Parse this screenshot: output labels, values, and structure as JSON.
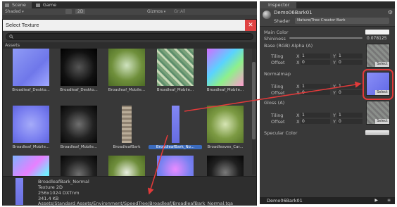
{
  "scene": {
    "tabs": [
      "Scene",
      "Game"
    ],
    "toolbar": {
      "shading": "Shaded",
      "mode": "2D",
      "gizmos": "Gizmos",
      "search": "Gr:All"
    }
  },
  "dialog": {
    "title": "Select Texture",
    "close": "✕",
    "assets_label": "Assets",
    "items": [
      {
        "label": "Broadleaf_Deskto...",
        "kind": "normal"
      },
      {
        "label": "Broadleaf_Deskto...",
        "kind": "dark"
      },
      {
        "label": "Broadleaf_Mobile...",
        "kind": "green"
      },
      {
        "label": "Broadleaf_Mobile...",
        "kind": "mosaic"
      },
      {
        "label": "Broadleaf_Mobile...",
        "kind": "normal-rainbow"
      },
      {
        "label": "Broadleaf_Mobile...",
        "kind": "normal-leaf"
      },
      {
        "label": "Broadleaf_Mobile...",
        "kind": "dark-leaf"
      },
      {
        "label": "BroadleafBark",
        "kind": "bark"
      },
      {
        "label": "BroadleafBark_No...",
        "kind": "bark-normal",
        "selected": true
      },
      {
        "label": "Broadleaves_Car...",
        "kind": "green-leaf"
      },
      {
        "label": "",
        "kind": "rainbow-leaf"
      },
      {
        "label": "",
        "kind": "dark-leaf"
      },
      {
        "label": "",
        "kind": "green-tree"
      },
      {
        "label": "",
        "kind": "normal-tree"
      },
      {
        "label": "",
        "kind": "dark-tree"
      }
    ],
    "preview": {
      "name": "BroadleafBark_Normal",
      "type": "Texture 2D",
      "dims": "256x1024  DXTnm",
      "size": "341.4 KB",
      "path": "Assets/Standard Assets/Environment/SpeedTree/Broadleaf/BroadleafBark_Normal.tga"
    }
  },
  "inspector": {
    "tab": "Inspector",
    "object_name": "Demo06Bark01",
    "shader_label": "Shader",
    "shader_value": "Nature/Tree Creator Bark",
    "main_color": "Main Color",
    "shininess": "Shininess",
    "shininess_value": "0.078125",
    "base_tex": "Base (RGB) Alpha (A)",
    "normalmap": "Normalmap",
    "gloss": "Gloss (A)",
    "specular": "Specular Color",
    "tiling": "Tiling",
    "offset": "Offset",
    "x": "X",
    "y": "Y",
    "one": "1",
    "zero": "0",
    "select": "Select",
    "footer": "Demo06Bark01"
  },
  "colors": {
    "highlight": "#e23a3a",
    "selection": "#3b6bbd"
  }
}
